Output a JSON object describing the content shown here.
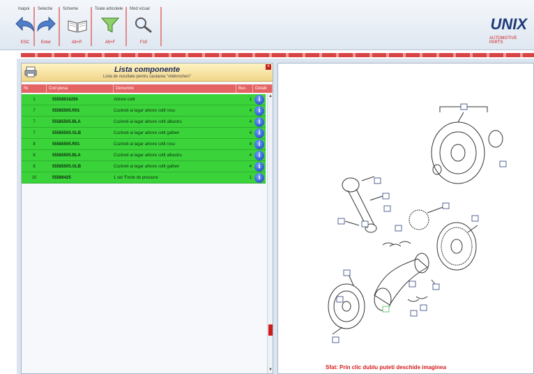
{
  "toolbar": {
    "groups": [
      {
        "label": "Inapoi"
      },
      {
        "label": "Selectie"
      },
      {
        "label": "Scheme"
      },
      {
        "label": "Toate articolele"
      },
      {
        "label": "Mod vizual"
      }
    ],
    "buttons": [
      {
        "label": "ESC",
        "icon": "back-arrow-icon"
      },
      {
        "label": "Enter",
        "icon": "forward-arrow-icon"
      },
      {
        "label": "Alt+P",
        "icon": "open-book-icon"
      },
      {
        "label": "Alt+F",
        "icon": "funnel-icon"
      },
      {
        "label": "F10",
        "icon": "magnifier-icon"
      }
    ]
  },
  "logo": {
    "text": "UNIX",
    "subtitle": "AUTOMOTIVE PARTS"
  },
  "panel": {
    "title": "Lista componente",
    "subtitle": "Lista de rezultate pentru cautarea \"vilebrochen\"",
    "columns": [
      "Nr.",
      "Cod piesa",
      "Denumire",
      "Buc.",
      "Detalii"
    ]
  },
  "rows": [
    {
      "nr": "1",
      "cod": "55558016256",
      "den": "Arbore cotit",
      "buc": "1"
    },
    {
      "nr": "7",
      "cod": "55585505.R01",
      "den": "Cuzineti ai lagar arbore cotit rosu",
      "buc": "4"
    },
    {
      "nr": "7",
      "cod": "55585505.BLA",
      "den": "Cuzineti ai lagar arbore cotit albastru",
      "buc": "4"
    },
    {
      "nr": "7",
      "cod": "55585505.GLB",
      "den": "Cuzineti ai lagar arbore cotit galben",
      "buc": "4"
    },
    {
      "nr": "8",
      "cod": "55585505.R01",
      "den": "Cuzineti ai lagar arbore cotit rosu",
      "buc": "4"
    },
    {
      "nr": "8",
      "cod": "55585505.BLA",
      "den": "Cuzineti ai lagar arbore cotit albastru",
      "buc": "4"
    },
    {
      "nr": "8",
      "cod": "55585505.GLB",
      "den": "Cuzineti ai lagar arbore cotit galben",
      "buc": "4"
    },
    {
      "nr": "10",
      "cod": "55586425",
      "den": "1 set 'Fecte de presiune",
      "buc": "1"
    }
  ],
  "diagram": {
    "hint": "Sfat: Prin clic dublu puteti deschide imaginea"
  },
  "colors": {
    "row_green": "#3ad43a",
    "header_red": "#e46464",
    "title_yellow": "#f2d58a",
    "info_blue": "#1a3fb8"
  }
}
